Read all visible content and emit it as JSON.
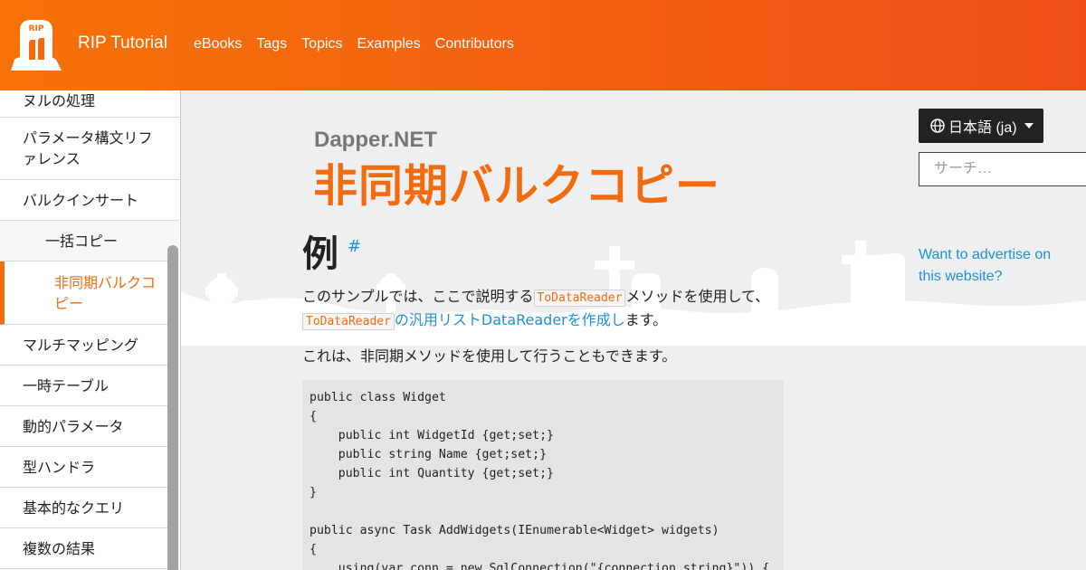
{
  "header": {
    "logo_text": "RIP",
    "brand": "RIP Tutorial",
    "nav": [
      "eBooks",
      "Tags",
      "Topics",
      "Examples",
      "Contributors"
    ]
  },
  "sidebar": {
    "items": [
      {
        "label": "ヌルの処理",
        "type": "normal"
      },
      {
        "label": "パラメータ構文リファレンス",
        "type": "normal"
      },
      {
        "label": "バルクインサート",
        "type": "normal"
      },
      {
        "label": "一括コピー",
        "type": "sub"
      },
      {
        "label": "非同期バルクコピー",
        "type": "active"
      },
      {
        "label": "マルチマッピング",
        "type": "normal"
      },
      {
        "label": "一時テーブル",
        "type": "normal"
      },
      {
        "label": "動的パラメータ",
        "type": "normal"
      },
      {
        "label": "型ハンドラ",
        "type": "normal"
      },
      {
        "label": "基本的なクエリ",
        "type": "normal"
      },
      {
        "label": "複数の結果",
        "type": "normal"
      }
    ]
  },
  "main": {
    "crumb": "Dapper.NET",
    "title": "非同期バルクコピー",
    "section": "例",
    "anchor": "#",
    "para1": {
      "prefix": "このサンプルでは、ここで説明する",
      "code1": "ToDataReader",
      "middle": "メソッドを使用して、",
      "code2": "ToDataReader",
      "link": "の汎用リストDataReaderを作成し",
      "suffix": "ます。"
    },
    "para2": "これは、非同期メソッドを使用して行うこともできます。",
    "code": "public class Widget\n{\n    public int WidgetId {get;set;}\n    public string Name {get;set;}\n    public int Quantity {get;set;}\n}\n\npublic async Task AddWidgets(IEnumerable<Widget> widgets)\n{\n    using(var conn = new SqlConnection(\"{connection string}\")) {"
  },
  "right": {
    "language": "日本語 (ja)",
    "search_placeholder": "サーチ…",
    "advert": "Want to advertise on this website?"
  },
  "colors": {
    "accent": "#f26b0f",
    "link": "#1e90d8",
    "header_start": "#f67208",
    "header_end": "#ef4f17"
  }
}
